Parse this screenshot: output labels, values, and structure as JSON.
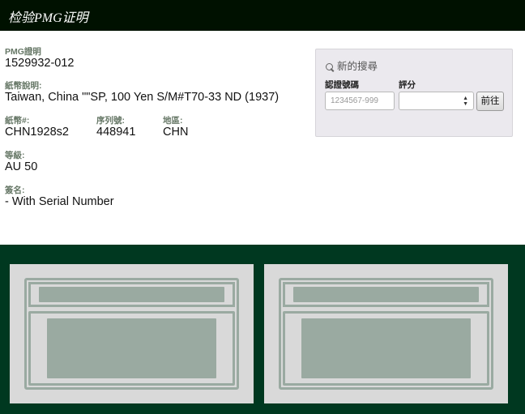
{
  "header": {
    "title": "检验PMG证明"
  },
  "details": {
    "cert": {
      "label": "PMG證明",
      "value": "1529932-012"
    },
    "description": {
      "label": "紙幣說明:",
      "value": "Taiwan, China \"\"SP, 100 Yen S/M#T70-33 ND (1937)"
    },
    "note_number": {
      "label": "紙幣#:",
      "value": "CHN1928s2"
    },
    "serial": {
      "label": "序列號:",
      "value": "448941"
    },
    "region": {
      "label": "地區:",
      "value": "CHN"
    },
    "grade": {
      "label": "等級:",
      "value": "AU 50"
    },
    "signature": {
      "label": "簽名:",
      "value": "- With Serial Number"
    }
  },
  "search": {
    "title": "新的搜尋",
    "cert_label": "認證號碼",
    "cert_placeholder": "1234567-999",
    "grade_label": "評分",
    "grade_value": "",
    "go_label": "前往"
  },
  "colors": {
    "header_bg": "#001100",
    "gallery_bg": "#003820",
    "slab_placeholder": "#9aaaa1"
  }
}
